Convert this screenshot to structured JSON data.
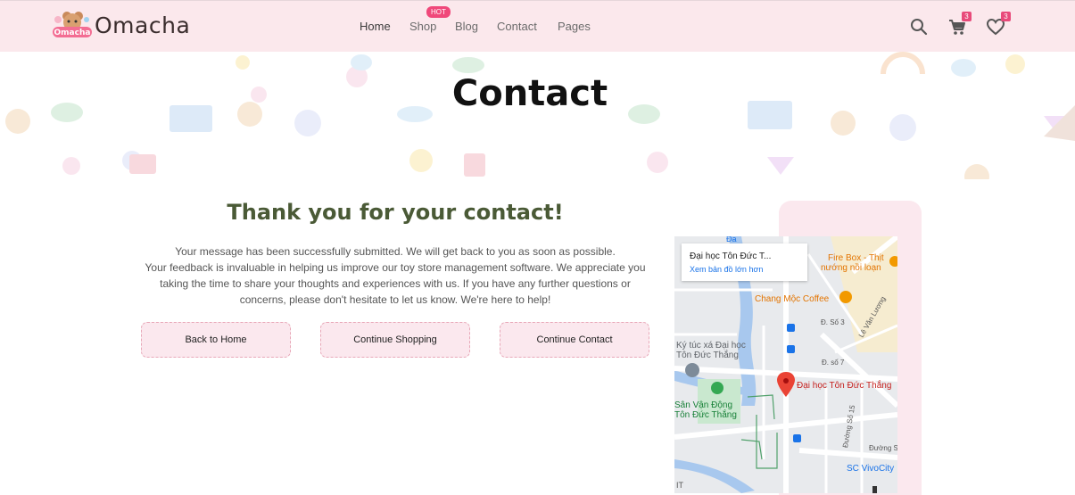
{
  "header": {
    "logo_badge": "Omacha",
    "logo_text": "Omacha",
    "nav": [
      {
        "label": "Home"
      },
      {
        "label": "Shop"
      },
      {
        "label": "Blog"
      },
      {
        "label": "Contact"
      },
      {
        "label": "Pages"
      }
    ],
    "hot_badge": "HOT",
    "cart_count": "3",
    "wishlist_count": "3",
    "icons": [
      "search-icon",
      "cart-icon",
      "heart-icon"
    ],
    "accent": "#f0487a"
  },
  "banner": {
    "title": "Contact"
  },
  "thanks": {
    "title": "Thank you for your contact!",
    "line1": "Your message has been successfully submitted. We will get back to you as soon as possible.",
    "line2": "Your feedback is invaluable in helping us improve our toy store management software. We appreciate you",
    "line3": "taking the time to share your thoughts and experiences with us. If you have any further questions or",
    "line4": "concerns, please don't hesitate to let us know. We're here to help!"
  },
  "buttons": {
    "home": "Back to Home",
    "shopping": "Continue Shopping",
    "contact": "Continue Contact"
  },
  "map": {
    "place_name": "Đại học Tôn Đức T...",
    "view_larger": "Xem bản đồ lớn hơn",
    "labels": {
      "firebox": "Fire Box - Thịt",
      "firebox2": "nướng nồi loạn",
      "coffee": "Chang Mộc Coffee",
      "dorm1": "Ký túc xá Đại học",
      "dorm2": "Tôn Đức Thắng",
      "pin": "Đại học Tôn Đức Thắng",
      "stadium1": "Sân Vận Động",
      "stadium2": "Tôn Đức Thắng",
      "street1": "Đ. Số 3",
      "street2": "Đ. số 7",
      "street3": "Lê Văn Lương",
      "street4": "Đường Số 15",
      "street5": "Đường Số",
      "vivocity": "SC VivoCity",
      "edge": "IT",
      "top": "Đa"
    }
  }
}
